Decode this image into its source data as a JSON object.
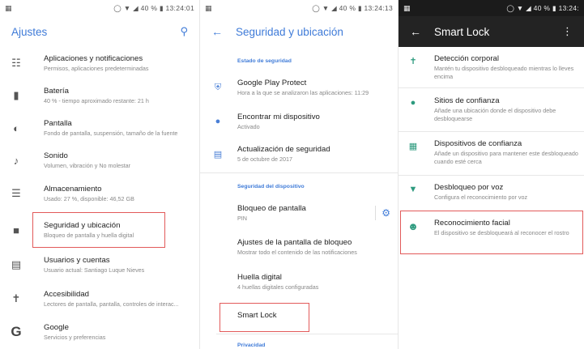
{
  "status": {
    "p1": {
      "time": "13:24:01",
      "battery": "40 %"
    },
    "p2": {
      "time": "13:24:13",
      "battery": "40 %"
    },
    "p3": {
      "time": "13:24:",
      "battery": "40 %"
    }
  },
  "settings": {
    "title": "Ajustes",
    "items": [
      {
        "icon": "apps-grid-icon",
        "title": "Aplicaciones y notificaciones",
        "subtitle": "Permisos, aplicaciones predeterminadas"
      },
      {
        "icon": "battery-icon",
        "title": "Batería",
        "subtitle": "40 % - tiempo aproximado restante: 21 h"
      },
      {
        "icon": "display-brightness-icon",
        "title": "Pantalla",
        "subtitle": "Fondo de pantalla, suspensión, tamaño de la fuente"
      },
      {
        "icon": "volume-icon",
        "title": "Sonido",
        "subtitle": "Volumen, vibración y No molestar"
      },
      {
        "icon": "storage-icon",
        "title": "Almacenamiento",
        "subtitle": "Usado: 27 %, disponible: 46,52 GB"
      },
      {
        "icon": "lock-icon",
        "title": "Seguridad y ubicación",
        "subtitle": "Bloqueo de pantalla y huella digital"
      },
      {
        "icon": "account-icon",
        "title": "Usuarios y cuentas",
        "subtitle": "Usuario actual: Santiago Luque Nieves"
      },
      {
        "icon": "accessibility-icon",
        "title": "Accesibilidad",
        "subtitle": "Lectores de pantalla, pantalla, controles de interac..."
      },
      {
        "icon": "google-icon",
        "title": "Google",
        "subtitle": "Servicios y preferencias"
      }
    ]
  },
  "security": {
    "title": "Seguridad y ubicación",
    "section_status": "Estado de seguridad",
    "status_items": [
      {
        "icon": "shield-icon",
        "title": "Google Play Protect",
        "subtitle": "Hora a la que se analizaron las aplicaciones: 11:29"
      },
      {
        "icon": "location-icon",
        "title": "Encontrar mi dispositivo",
        "subtitle": "Activado"
      },
      {
        "icon": "update-icon",
        "title": "Actualización de seguridad",
        "subtitle": "5 de octubre de 2017"
      }
    ],
    "section_device": "Seguridad del dispositivo",
    "device_items": [
      {
        "title": "Bloqueo de pantalla",
        "subtitle": "PIN"
      },
      {
        "title": "Ajustes de la pantalla de bloqueo",
        "subtitle": "Mostrar todo el contenido de las notificaciones"
      },
      {
        "title": "Huella digital",
        "subtitle": "4 huellas digitales configuradas"
      },
      {
        "title": "Smart Lock",
        "subtitle": ""
      }
    ],
    "section_privacy": "Privacidad"
  },
  "smartlock": {
    "title": "Smart Lock",
    "items": [
      {
        "icon": "walking-person-icon",
        "title": "Detección corporal",
        "subtitle": "Mantén tu dispositivo desbloqueado mientras lo lleves encima"
      },
      {
        "icon": "map-pin-icon",
        "title": "Sitios de confianza",
        "subtitle": "Añade una ubicación donde el dispositivo debe desbloquearse"
      },
      {
        "icon": "trusted-devices-icon",
        "title": "Dispositivos de confianza",
        "subtitle": "Añade un dispositivo para mantener este desbloqueado cuando esté cerca"
      },
      {
        "icon": "microphone-icon",
        "title": "Desbloqueo por voz",
        "subtitle": "Configura el reconocimiento por voz"
      },
      {
        "icon": "face-icon",
        "title": "Reconocimiento facial",
        "subtitle": "El dispositivo se desbloqueará al reconocer el rostro"
      }
    ]
  },
  "colors": {
    "accent": "#3f7bd8",
    "highlight": "#e25a5a",
    "smartlock_icon": "#2d9a7e",
    "dark_bar": "#232323"
  }
}
